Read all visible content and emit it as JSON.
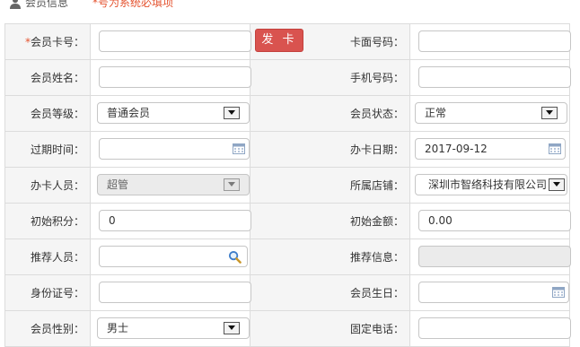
{
  "header": {
    "title": "会员信息",
    "note": "*号为系统必填项"
  },
  "buttons": {
    "issue_card": "发 卡"
  },
  "form": {
    "card_no_label": "会员卡号：",
    "card_no_required_mark": "*",
    "card_no_value": "",
    "card_face_no_label": "卡面号码：",
    "card_face_no_value": "",
    "name_label": "会员姓名：",
    "name_value": "",
    "mobile_label": "手机号码：",
    "mobile_value": "",
    "level_label": "会员等级：",
    "level_value": "普通会员",
    "status_label": "会员状态：",
    "status_value": "正常",
    "expire_label": "过期时间：",
    "expire_value": "",
    "issue_date_label": "办卡日期：",
    "issue_date_value": "2017-09-12",
    "operator_label": "办卡人员：",
    "operator_value": "超管",
    "store_label": "所属店铺：",
    "store_value": "深圳市智络科技有限公司",
    "init_points_label": "初始积分：",
    "init_points_value": "0",
    "init_amount_label": "初始金额：",
    "init_amount_value": "0.00",
    "referrer_label": "推荐人员：",
    "referrer_value": "",
    "referrer_info_label": "推荐信息：",
    "referrer_info_value": "",
    "id_no_label": "身份证号：",
    "id_no_value": "",
    "birthday_label": "会员生日：",
    "birthday_value": "",
    "gender_label": "会员性别：",
    "gender_value": "男士",
    "phone_label": "固定电话：",
    "phone_value": ""
  },
  "colors": {
    "required": "#e4532f",
    "button": "#d9534f",
    "label_bg": "#f5f5f5",
    "border": "#dcdcdc"
  }
}
